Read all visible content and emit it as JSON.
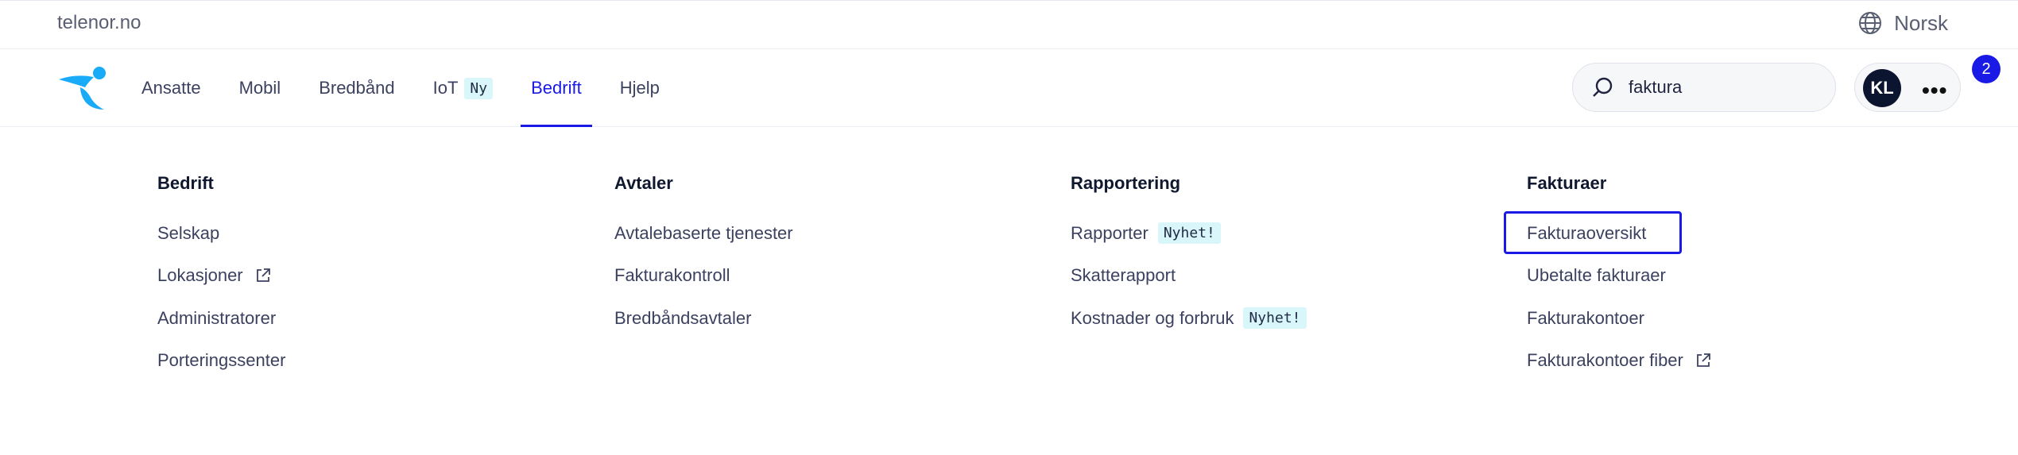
{
  "topbar": {
    "site_link": "telenor.no",
    "language": "Norsk",
    "language_icon": "globe-icon"
  },
  "nav": {
    "logo_icon": "telenor-logo",
    "items": [
      {
        "label": "Ansatte"
      },
      {
        "label": "Mobil"
      },
      {
        "label": "Bredbånd"
      },
      {
        "label": "IoT",
        "tag": "Ny"
      },
      {
        "label": "Bedrift",
        "active": true
      },
      {
        "label": "Hjelp"
      }
    ]
  },
  "search": {
    "value": "faktura",
    "icon": "search-icon"
  },
  "user": {
    "initials": "KL",
    "notification_count": "2",
    "more_icon": "more-icon"
  },
  "menu": {
    "columns": [
      {
        "title": "Bedrift",
        "items": [
          {
            "label": "Selskap"
          },
          {
            "label": "Lokasjoner",
            "external": true
          },
          {
            "label": "Administratorer"
          },
          {
            "label": "Porteringssenter"
          }
        ]
      },
      {
        "title": "Avtaler",
        "items": [
          {
            "label": "Avtalebaserte tjenester"
          },
          {
            "label": "Fakturakontroll"
          },
          {
            "label": "Bredbåndsavtaler"
          }
        ]
      },
      {
        "title": "Rapportering",
        "items": [
          {
            "label": "Rapporter",
            "tag": "Nyhet!"
          },
          {
            "label": "Skatterapport"
          },
          {
            "label": "Kostnader og forbruk",
            "tag": "Nyhet!"
          }
        ]
      },
      {
        "title": "Fakturaer",
        "items": [
          {
            "label": "Fakturaoversikt",
            "highlighted": true
          },
          {
            "label": "Ubetalte fakturaer"
          },
          {
            "label": "Fakturakontoer"
          },
          {
            "label": "Fakturakontoer fiber",
            "external": true
          }
        ]
      }
    ]
  },
  "colors": {
    "accent": "#1a1ae6",
    "tag_bg": "#d9f6fb",
    "logo": "#19aaf8",
    "text": "#3c4160",
    "heading": "#101830"
  }
}
